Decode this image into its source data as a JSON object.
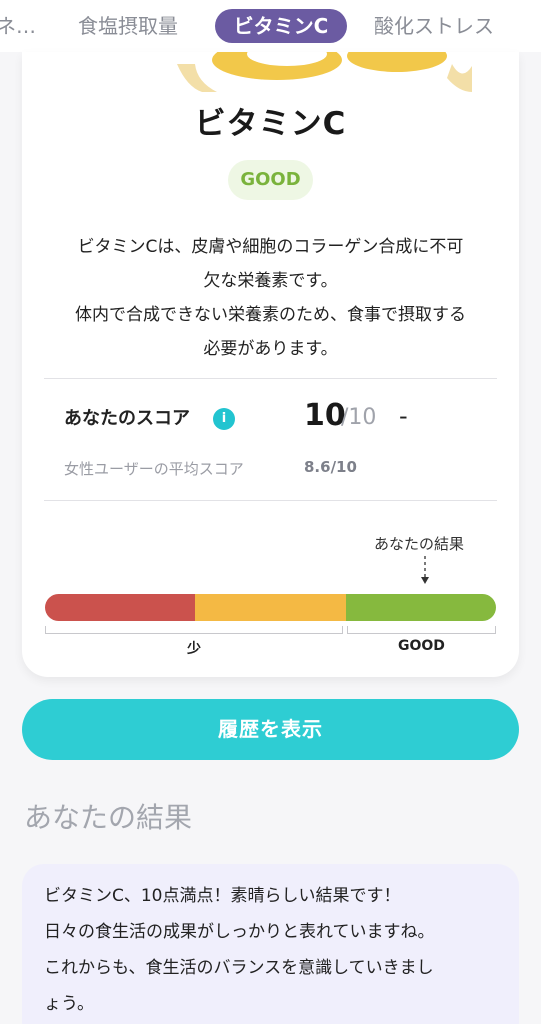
{
  "tabs": [
    {
      "label": "ネ…"
    },
    {
      "label": "食塩摂取量"
    },
    {
      "label": "ビタミンC"
    },
    {
      "label": "酸化ストレス"
    }
  ],
  "card": {
    "title": "ビタミンC",
    "badge": "GOOD",
    "description": [
      "ビタミンCは、皮膚や細胞のコラーゲン合成に不可",
      "欠な栄養素です。",
      "体内で合成できない栄養素のため、食事で摂取する",
      "必要があります。"
    ],
    "score": {
      "label": "あなたのスコア",
      "value": "10",
      "max": "/10",
      "trend": "-"
    },
    "average": {
      "label": "女性ユーザーの平均スコア",
      "value": "8.6/10"
    },
    "gauge": {
      "marker_label": "あなたの結果",
      "segment_colors": [
        "#cb524d",
        "#f4b944",
        "#86b93e"
      ],
      "range_labels": [
        "少",
        "GOOD"
      ]
    }
  },
  "history_button": "履歴を表示",
  "result": {
    "title": "あなたの結果",
    "message": [
      "ビタミンC、10点満点！素晴らしい結果です！",
      "日々の食生活の成果がしっかりと表れていますね。",
      "これからも、食生活のバランスを意識していきまし",
      "ょう。"
    ]
  },
  "colors": {
    "accent_purple": "#6b5ba2",
    "accent_teal": "#2ecdd3",
    "good_green": "#7ab33c"
  }
}
